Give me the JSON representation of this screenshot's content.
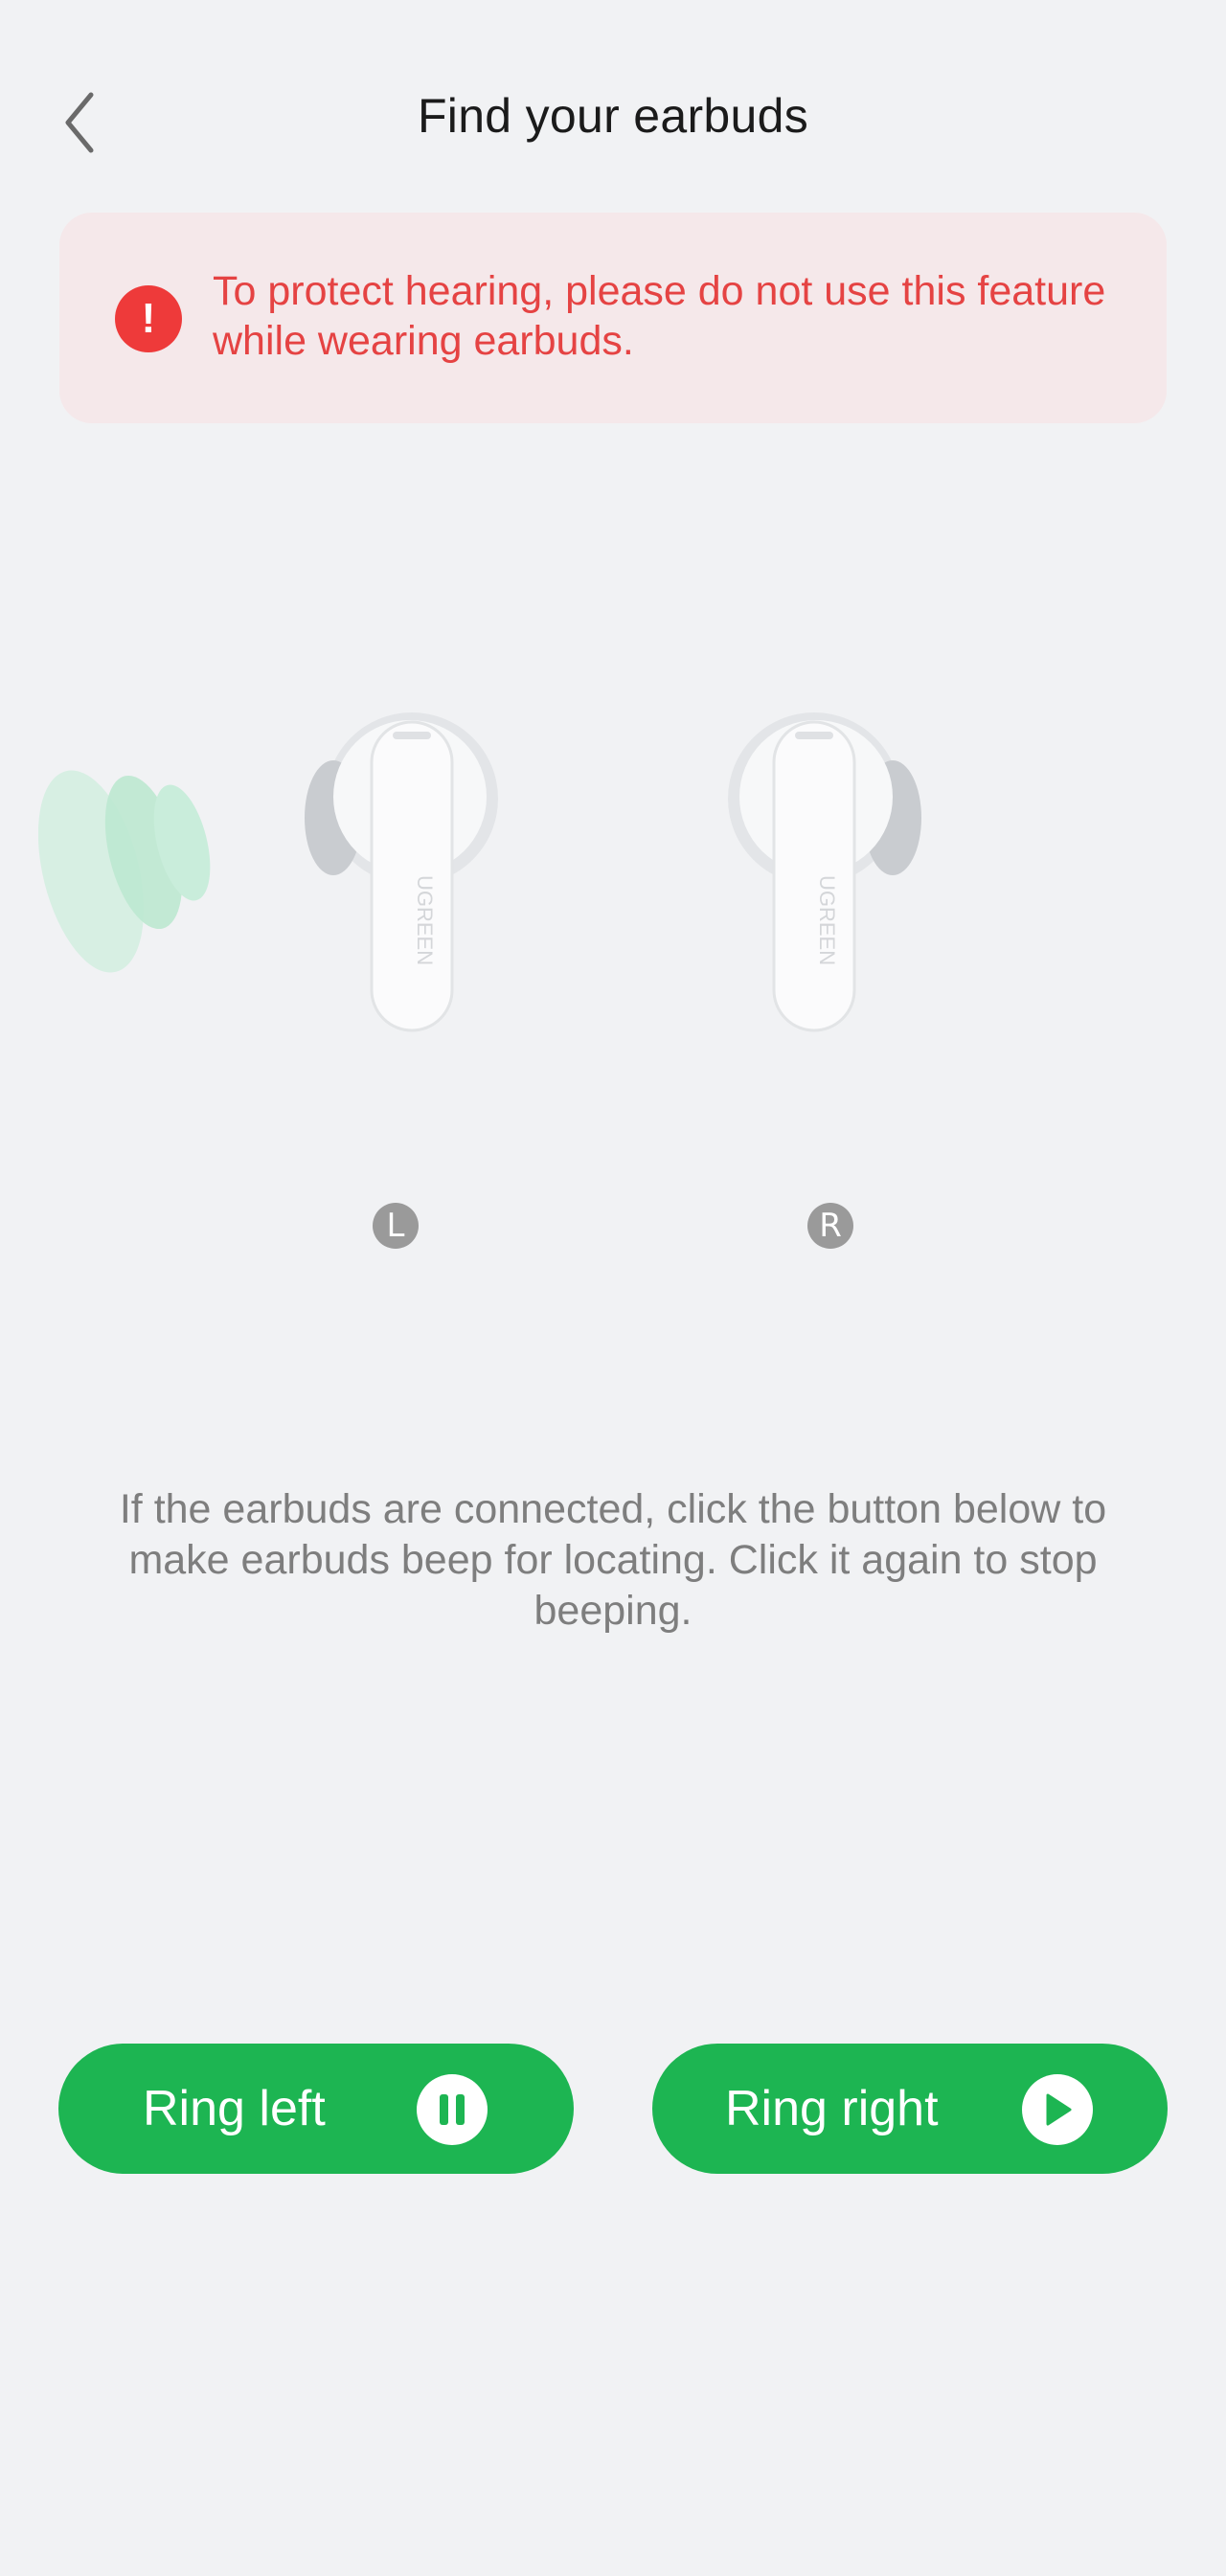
{
  "header": {
    "title": "Find your earbuds",
    "back_icon": "chevron-left-icon"
  },
  "warning": {
    "icon": "exclamation-icon",
    "text": "To protect hearing, please do not use this feature while wearing earbuds."
  },
  "earbuds": {
    "left_label": "L",
    "right_label": "R",
    "brand": "UGREEN"
  },
  "instructions": "If the earbuds are connected, click the button below to make earbuds beep for locating. Click it again to stop beeping.",
  "buttons": {
    "ring_left": {
      "label": "Ring left",
      "icon": "pause-icon"
    },
    "ring_right": {
      "label": "Ring right",
      "icon": "play-icon"
    }
  },
  "colors": {
    "accent": "#1db552",
    "warning": "#ee3a3a",
    "warning_bg": "#f5e8ea",
    "background": "#f1f2f4"
  }
}
